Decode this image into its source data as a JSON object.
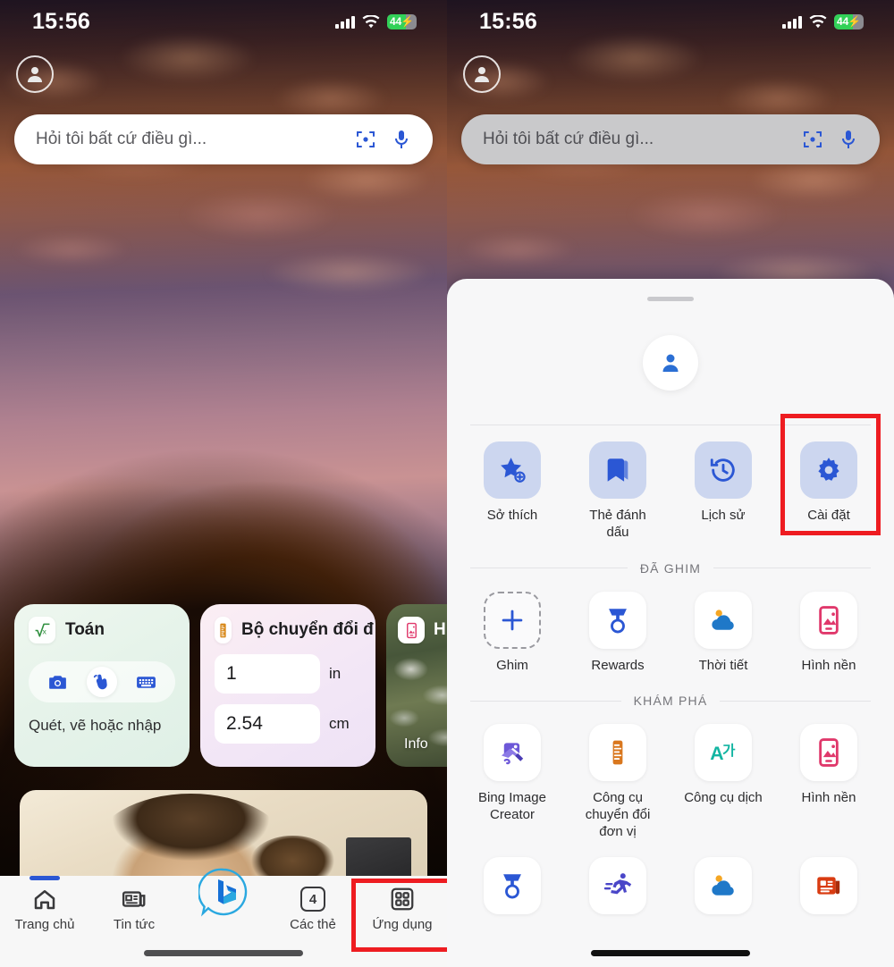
{
  "status": {
    "time": "15:56",
    "battery_level": "44",
    "battery_charging_icon": "bolt-icon",
    "signal_icon": "cellular-bars-icon",
    "wifi_icon": "wifi-icon"
  },
  "search": {
    "placeholder": "Hỏi tôi bất cứ điều gì...",
    "camera_icon": "visual-search-icon",
    "mic_icon": "microphone-icon"
  },
  "widgets": {
    "math": {
      "title": "Toán",
      "badge_icon": "square-root-icon",
      "subtitle": "Quét, vẽ hoặc nhập",
      "actions": [
        "camera-icon",
        "draw-hand-icon",
        "keyboard-icon"
      ]
    },
    "converter": {
      "title": "Bộ chuyển đổi đ",
      "badge_icon": "ruler-icon",
      "from_value": "1",
      "from_unit": "in",
      "to_value": "2.54",
      "to_unit": "cm"
    },
    "wallpaper_peek": {
      "title": "H",
      "badge_icon": "wallpaper-icon",
      "info_label": "Info"
    }
  },
  "bottom_nav": {
    "items": [
      {
        "label": "Trang chủ",
        "icon": "home-icon",
        "active": true
      },
      {
        "label": "Tin tức",
        "icon": "news-icon",
        "active": false
      },
      {
        "label": "",
        "icon": "bing-logo-icon",
        "active": false
      },
      {
        "label": "Các thẻ",
        "icon": "tabs-icon",
        "badge": "4",
        "active": false
      },
      {
        "label": "Ứng dụng",
        "icon": "apps-grid-icon",
        "active": false,
        "highlighted": true
      }
    ]
  },
  "sheet": {
    "avatar_icon": "person-icon",
    "quick_actions": [
      {
        "label": "Sở thích",
        "icon": "star-plus-icon",
        "highlighted": false
      },
      {
        "label": "Thẻ đánh dấu",
        "icon": "bookmark-icon",
        "highlighted": false
      },
      {
        "label": "Lịch sử",
        "icon": "history-icon",
        "highlighted": false
      },
      {
        "label": "Cài đặt",
        "icon": "gear-icon",
        "highlighted": true
      }
    ],
    "pinned": {
      "section_title": "ĐÃ GHIM",
      "items": [
        {
          "label": "Ghim",
          "icon": "plus-icon",
          "style": "dashed"
        },
        {
          "label": "Rewards",
          "icon": "medal-icon",
          "style": "white"
        },
        {
          "label": "Thời tiết",
          "icon": "weather-icon",
          "style": "white"
        },
        {
          "label": "Hình nền",
          "icon": "wallpaper-icon",
          "style": "white"
        }
      ]
    },
    "explore": {
      "section_title": "KHÁM PHÁ",
      "items": [
        {
          "label": "Bing Image Creator",
          "icon": "image-creator-icon",
          "style": "white"
        },
        {
          "label": "Công cụ chuyển đổi đơn vị",
          "icon": "ruler-icon",
          "style": "white"
        },
        {
          "label": "Công cụ dịch",
          "icon": "translate-icon",
          "style": "white"
        },
        {
          "label": "Hình nền",
          "icon": "wallpaper-icon",
          "style": "white"
        }
      ],
      "partial_row": [
        {
          "label": "",
          "icon": "medal-icon",
          "style": "white"
        },
        {
          "label": "",
          "icon": "running-icon",
          "style": "white"
        },
        {
          "label": "",
          "icon": "weather-icon",
          "style": "white"
        },
        {
          "label": "",
          "icon": "news-red-icon",
          "style": "white"
        }
      ]
    }
  },
  "colors": {
    "accent": "#2b57d4",
    "highlight": "#ee1c21",
    "tile_soft": "#ccd6ef",
    "battery_green": "#32d158"
  }
}
